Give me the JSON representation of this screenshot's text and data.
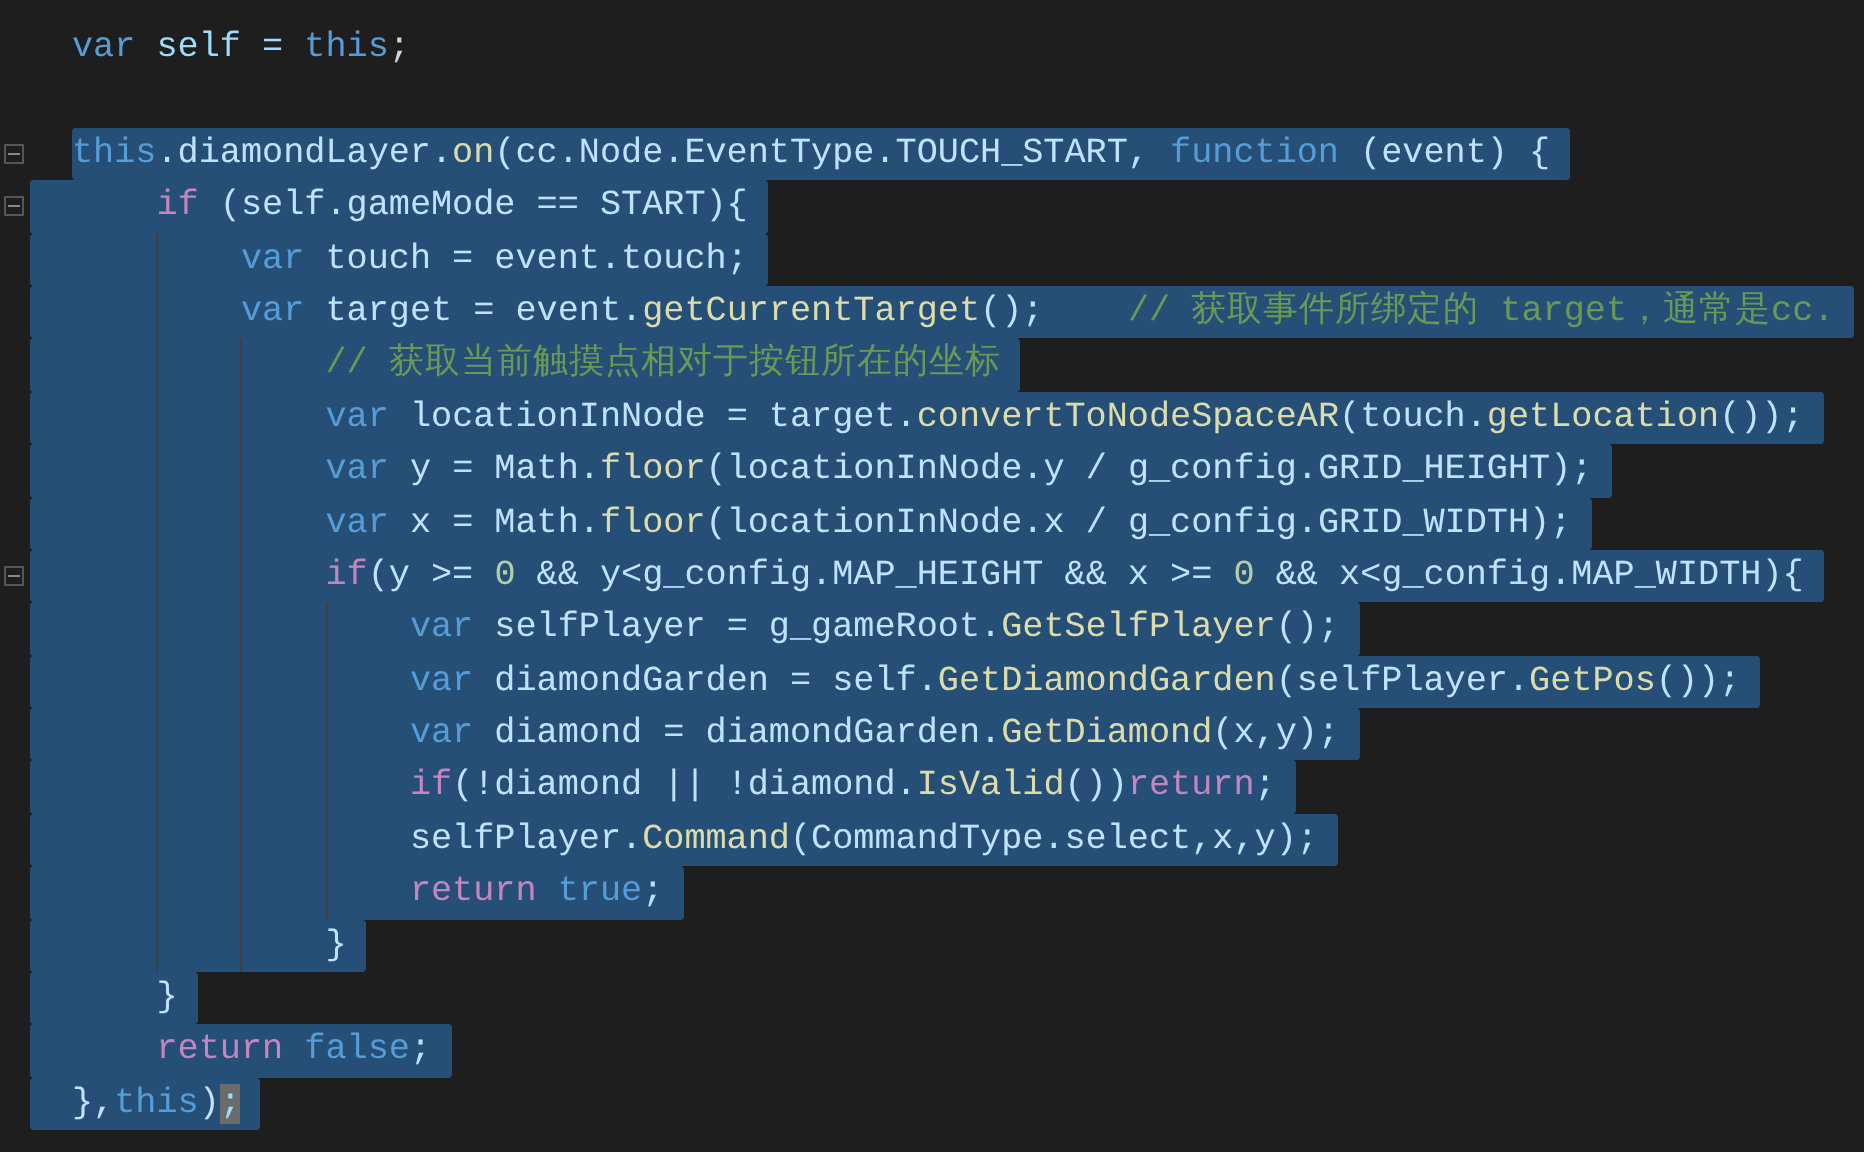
{
  "editor": {
    "lines": [
      {
        "selected": false,
        "foldable": false,
        "tokens": [
          {
            "text": "var",
            "kind": "kw"
          },
          {
            "text": " self = ",
            "kind": "id"
          },
          {
            "text": "this",
            "kind": "kw"
          },
          {
            "text": ";",
            "kind": "plain"
          }
        ]
      },
      {
        "foldable": false
      },
      {
        "selected": true,
        "foldable": true,
        "tokens": [
          {
            "text": "this",
            "kind": "kw"
          },
          {
            "text": ".diamondLayer.",
            "kind": "id"
          },
          {
            "text": "on",
            "kind": "fn"
          },
          {
            "text": "(cc.Node.EventType.TOUCH_START, ",
            "kind": "id"
          },
          {
            "text": "function",
            "kind": "kw"
          },
          {
            "text": " (event) {",
            "kind": "id"
          }
        ],
        "children": [
          {
            "selected": true,
            "foldable": true,
            "tokens": [
              {
                "text": "if",
                "kind": "ctl"
              },
              {
                "text": " (self.gameMode == START){",
                "kind": "id"
              }
            ],
            "children": [
              {
                "selected": true,
                "foldable": false,
                "tokens": [
                  {
                    "text": "var",
                    "kind": "kw"
                  },
                  {
                    "text": " touch = event.touch;",
                    "kind": "id"
                  }
                ]
              },
              {
                "selected": true,
                "foldable": false,
                "tokens": [
                  {
                    "text": "var",
                    "kind": "kw"
                  },
                  {
                    "text": " target = event.",
                    "kind": "id"
                  },
                  {
                    "text": "getCurrentTarget",
                    "kind": "fn"
                  },
                  {
                    "text": "();    ",
                    "kind": "id"
                  },
                  {
                    "text": "// 获取事件所绑定的 target，通常是cc.",
                    "kind": "cm"
                  }
                ],
                "children": [
                  {
                    "selected": true,
                    "foldable": false,
                    "tokens": [
                      {
                        "text": "// 获取当前触摸点相对于按钮所在的坐标",
                        "kind": "cm"
                      }
                    ]
                  },
                  {
                    "selected": true,
                    "foldable": false,
                    "tokens": [
                      {
                        "text": "var",
                        "kind": "kw"
                      },
                      {
                        "text": " locationInNode = target.",
                        "kind": "id"
                      },
                      {
                        "text": "convertToNodeSpaceAR",
                        "kind": "fn"
                      },
                      {
                        "text": "(touch.",
                        "kind": "id"
                      },
                      {
                        "text": "getLocation",
                        "kind": "fn"
                      },
                      {
                        "text": "());",
                        "kind": "id"
                      }
                    ]
                  },
                  {
                    "selected": true,
                    "foldable": false,
                    "tokens": [
                      {
                        "text": "var",
                        "kind": "kw"
                      },
                      {
                        "text": " y = Math.",
                        "kind": "id"
                      },
                      {
                        "text": "floor",
                        "kind": "fn"
                      },
                      {
                        "text": "(locationInNode.y / g_config.GRID_HEIGHT);",
                        "kind": "id"
                      }
                    ]
                  },
                  {
                    "selected": true,
                    "foldable": false,
                    "tokens": [
                      {
                        "text": "var",
                        "kind": "kw"
                      },
                      {
                        "text": " x = Math.",
                        "kind": "id"
                      },
                      {
                        "text": "floor",
                        "kind": "fn"
                      },
                      {
                        "text": "(locationInNode.x / g_config.GRID_WIDTH);",
                        "kind": "id"
                      }
                    ]
                  },
                  {
                    "selected": true,
                    "foldable": true,
                    "tokens": [
                      {
                        "text": "if",
                        "kind": "ctl"
                      },
                      {
                        "text": "(y >= ",
                        "kind": "id"
                      },
                      {
                        "text": "0",
                        "kind": "num"
                      },
                      {
                        "text": " && y<g_config.MAP_HEIGHT && x >= ",
                        "kind": "id"
                      },
                      {
                        "text": "0",
                        "kind": "num"
                      },
                      {
                        "text": " && x<g_config.MAP_WIDTH){",
                        "kind": "id"
                      }
                    ],
                    "children": [
                      {
                        "selected": true,
                        "foldable": false,
                        "tokens": [
                          {
                            "text": "var",
                            "kind": "kw"
                          },
                          {
                            "text": " selfPlayer = g_gameRoot.",
                            "kind": "id"
                          },
                          {
                            "text": "GetSelfPlayer",
                            "kind": "fn"
                          },
                          {
                            "text": "();",
                            "kind": "id"
                          }
                        ]
                      },
                      {
                        "selected": true,
                        "foldable": false,
                        "tokens": [
                          {
                            "text": "var",
                            "kind": "kw"
                          },
                          {
                            "text": " diamondGarden = self.",
                            "kind": "id"
                          },
                          {
                            "text": "GetDiamondGarden",
                            "kind": "fn"
                          },
                          {
                            "text": "(selfPlayer.",
                            "kind": "id"
                          },
                          {
                            "text": "GetPos",
                            "kind": "fn"
                          },
                          {
                            "text": "());",
                            "kind": "id"
                          }
                        ]
                      },
                      {
                        "selected": true,
                        "foldable": false,
                        "tokens": [
                          {
                            "text": "var",
                            "kind": "kw"
                          },
                          {
                            "text": " diamond = diamondGarden.",
                            "kind": "id"
                          },
                          {
                            "text": "GetDiamond",
                            "kind": "fn"
                          },
                          {
                            "text": "(x,y);",
                            "kind": "id"
                          }
                        ]
                      },
                      {
                        "selected": true,
                        "foldable": false,
                        "tokens": [
                          {
                            "text": "if",
                            "kind": "ctl"
                          },
                          {
                            "text": "(!diamond || !diamond.",
                            "kind": "id"
                          },
                          {
                            "text": "IsValid",
                            "kind": "fn"
                          },
                          {
                            "text": "())",
                            "kind": "id"
                          },
                          {
                            "text": "return",
                            "kind": "ctl"
                          },
                          {
                            "text": ";",
                            "kind": "id"
                          }
                        ]
                      },
                      {
                        "selected": true,
                        "foldable": false,
                        "tokens": [
                          {
                            "text": "selfPlayer.",
                            "kind": "id"
                          },
                          {
                            "text": "Command",
                            "kind": "fn"
                          },
                          {
                            "text": "(CommandType.select,x,y);",
                            "kind": "id"
                          }
                        ]
                      },
                      {
                        "selected": true,
                        "foldable": false,
                        "tokens": [
                          {
                            "text": "return",
                            "kind": "ctl"
                          },
                          {
                            "text": " true",
                            "kind": "kw"
                          },
                          {
                            "text": ";",
                            "kind": "id"
                          }
                        ]
                      }
                    ]
                  },
                  {
                    "selected": true,
                    "foldable": false,
                    "tokens": [
                      {
                        "text": "}",
                        "kind": "id"
                      }
                    ]
                  }
                ]
              }
            ]
          },
          {
            "selected": true,
            "foldable": false,
            "tokens": [
              {
                "text": "}",
                "kind": "id"
              }
            ]
          },
          {
            "selected": true,
            "foldable": false,
            "tokens": [
              {
                "text": "return",
                "kind": "ctl"
              },
              {
                "text": " false",
                "kind": "kw"
              },
              {
                "text": ";",
                "kind": "id"
              }
            ]
          }
        ]
      },
      {
        "selected": true,
        "foldable": false,
        "tokens": [
          {
            "text": "},",
            "kind": "id"
          },
          {
            "text": "this",
            "kind": "kw"
          },
          {
            "text": ")",
            "kind": "id"
          },
          {
            "text": ";",
            "kind": "caret"
          }
        ]
      }
    ]
  }
}
